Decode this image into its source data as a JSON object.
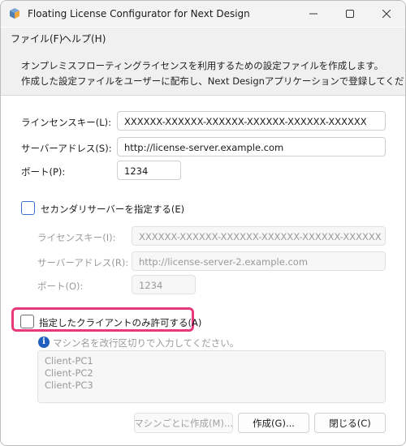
{
  "window": {
    "title": "Floating License Configurator for Next Design"
  },
  "menu": {
    "file": "ファイル(F)",
    "help": "ヘルプ(H)"
  },
  "description": {
    "line1": "オンプレミスフローティングライセンスを利用するための設定ファイルを作成します。",
    "line2": "作成した設定ファイルをユーザーに配布し、Next Designアプリケーションで登録してください。"
  },
  "primary": {
    "license_key_label": "ラインセンスキー(L):",
    "license_key_value": "XXXXXX-XXXXXX-XXXXXX-XXXXXX-XXXXXX-XXXXXX",
    "server_address_label": "サーバーアドレス(S):",
    "server_address_value": "http://license-server.example.com",
    "port_label": "ポート(P):",
    "port_value": "1234"
  },
  "secondary": {
    "checkbox_label": "セカンダリサーバーを指定する(E)",
    "checked": false,
    "license_key_label": "ライセンスキー(I):",
    "license_key_value": "XXXXXX-XXXXXX-XXXXXX-XXXXXX-XXXXXX-XXXXXX",
    "server_address_label": "サーバーアドレス(R):",
    "server_address_value": "http://license-server-2.example.com",
    "port_label": "ポート(O):",
    "port_value": "1234"
  },
  "client_restriction": {
    "checkbox_label": "指定したクライアントのみ許可する(A)",
    "checked": false,
    "hint": "マシン名を改行区切りで入力してください。",
    "machines": [
      "Client-PC1",
      "Client-PC2",
      "Client-PC3"
    ],
    "highlight_color": "#e8397a"
  },
  "buttons": {
    "create_per_machine": "マシンごとに作成(M)...",
    "create": "作成(G)...",
    "close": "閉じる(C)"
  },
  "colors": {
    "accent": "#3c6fd1",
    "info": "#1f5fbf",
    "highlight": "#e8397a"
  }
}
